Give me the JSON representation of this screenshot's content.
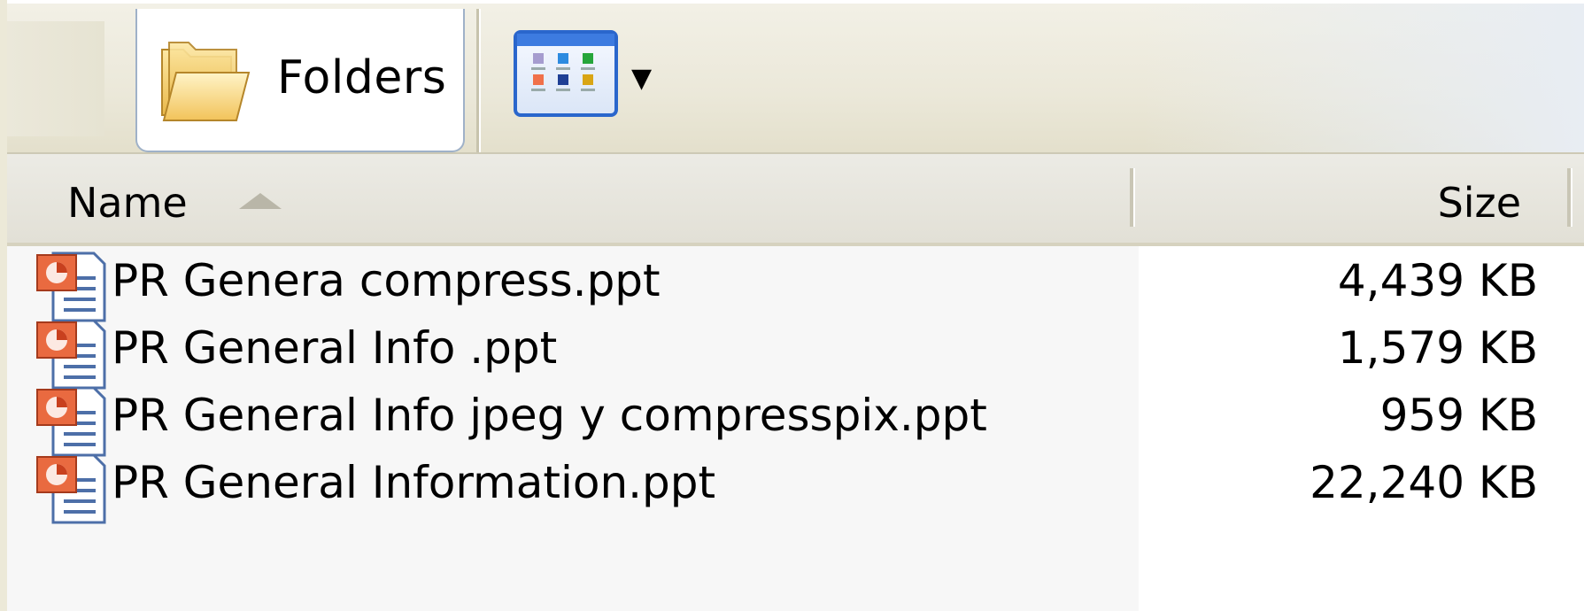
{
  "toolbar": {
    "folders_label": "Folders",
    "folders_icon": "folder-icon",
    "views_icon": "views-icon",
    "views_dropdown_icon": "dropdown-arrow-icon"
  },
  "columns": {
    "name": "Name",
    "size": "Size",
    "sort_icon": "sort-ascending-icon"
  },
  "files": [
    {
      "name": "PR Genera compress.ppt",
      "size": "4,439 KB",
      "icon": "powerpoint-file-icon"
    },
    {
      "name": "PR General Info .ppt",
      "size": "1,579 KB",
      "icon": "powerpoint-file-icon"
    },
    {
      "name": "PR General Info jpeg y compresspix.ppt",
      "size": "959 KB",
      "icon": "powerpoint-file-icon"
    },
    {
      "name": "PR General Information.ppt",
      "size": "22,240 KB",
      "icon": "powerpoint-file-icon"
    }
  ]
}
